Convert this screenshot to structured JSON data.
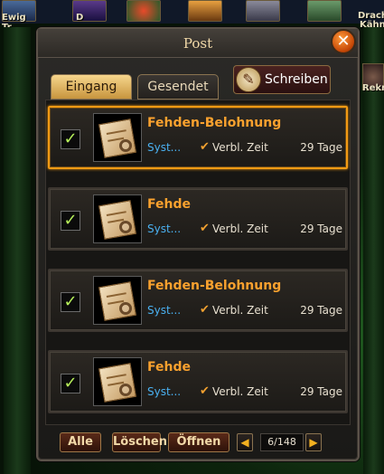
{
  "background": {
    "top_left_label": "Ewig\nTr",
    "top_mid_label": "D",
    "top_right_label_1": "Drach",
    "top_right_label_2": "Kähn",
    "side_label": "Rekru"
  },
  "window": {
    "title": "Post",
    "close_glyph": "✕"
  },
  "tabs": [
    {
      "label": "Eingang",
      "active": true
    },
    {
      "label": "Gesendet",
      "active": false
    }
  ],
  "write_button": {
    "label": "Schreiben",
    "icon": "quill-icon"
  },
  "mails": [
    {
      "checked": true,
      "subject": "Fehden-Belohnung",
      "sender": "Syst...",
      "time_label": "Verbl. Zeit",
      "days": "29 Tage",
      "selected": true
    },
    {
      "checked": true,
      "subject": "Fehde",
      "sender": "Syst...",
      "time_label": "Verbl. Zeit",
      "days": "29 Tage",
      "selected": false
    },
    {
      "checked": true,
      "subject": "Fehden-Belohnung",
      "sender": "Syst...",
      "time_label": "Verbl. Zeit",
      "days": "29 Tage",
      "selected": false
    },
    {
      "checked": true,
      "subject": "Fehde",
      "sender": "Syst...",
      "time_label": "Verbl. Zeit",
      "days": "29 Tage",
      "selected": false
    }
  ],
  "footer": {
    "all_label": "Alle",
    "delete_label": "Löschen",
    "open_label": "Öffnen",
    "page": "6/148"
  },
  "colors": {
    "subject": "#f9a12e",
    "sender": "#4ab0f0",
    "selected_border": "#f29a14",
    "check": "#b6f05a"
  }
}
